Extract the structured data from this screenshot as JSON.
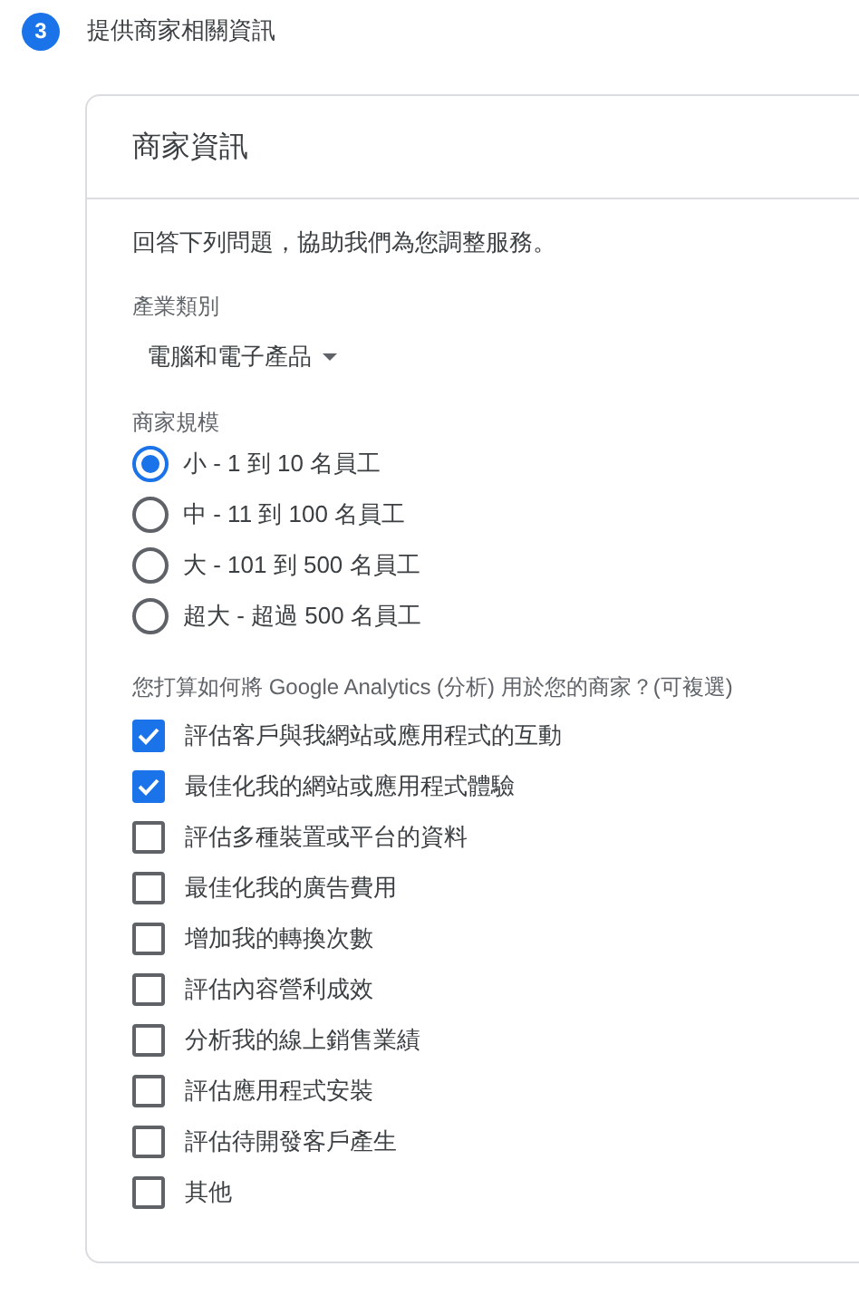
{
  "step": {
    "number": "3",
    "title": "提供商家相關資訊"
  },
  "card": {
    "title": "商家資訊",
    "intro": "回答下列問題，協助我們為您調整服務。",
    "industry": {
      "label": "產業類別",
      "value": "電腦和電子產品"
    },
    "size": {
      "label": "商家規模",
      "options": [
        {
          "label": "小 - 1 到 10 名員工",
          "selected": true
        },
        {
          "label": "中 - 11 到 100 名員工",
          "selected": false
        },
        {
          "label": "大 - 101 到 500 名員工",
          "selected": false
        },
        {
          "label": "超大 - 超過 500 名員工",
          "selected": false
        }
      ]
    },
    "usage": {
      "label": "您打算如何將 Google Analytics (分析) 用於您的商家？(可複選)",
      "options": [
        {
          "label": "評估客戶與我網站或應用程式的互動",
          "checked": true
        },
        {
          "label": "最佳化我的網站或應用程式體驗",
          "checked": true
        },
        {
          "label": "評估多種裝置或平台的資料",
          "checked": false
        },
        {
          "label": "最佳化我的廣告費用",
          "checked": false
        },
        {
          "label": "增加我的轉換次數",
          "checked": false
        },
        {
          "label": "評估內容營利成效",
          "checked": false
        },
        {
          "label": "分析我的線上銷售業績",
          "checked": false
        },
        {
          "label": "評估應用程式安裝",
          "checked": false
        },
        {
          "label": "評估待開發客戶產生",
          "checked": false
        },
        {
          "label": "其他",
          "checked": false
        }
      ]
    }
  }
}
